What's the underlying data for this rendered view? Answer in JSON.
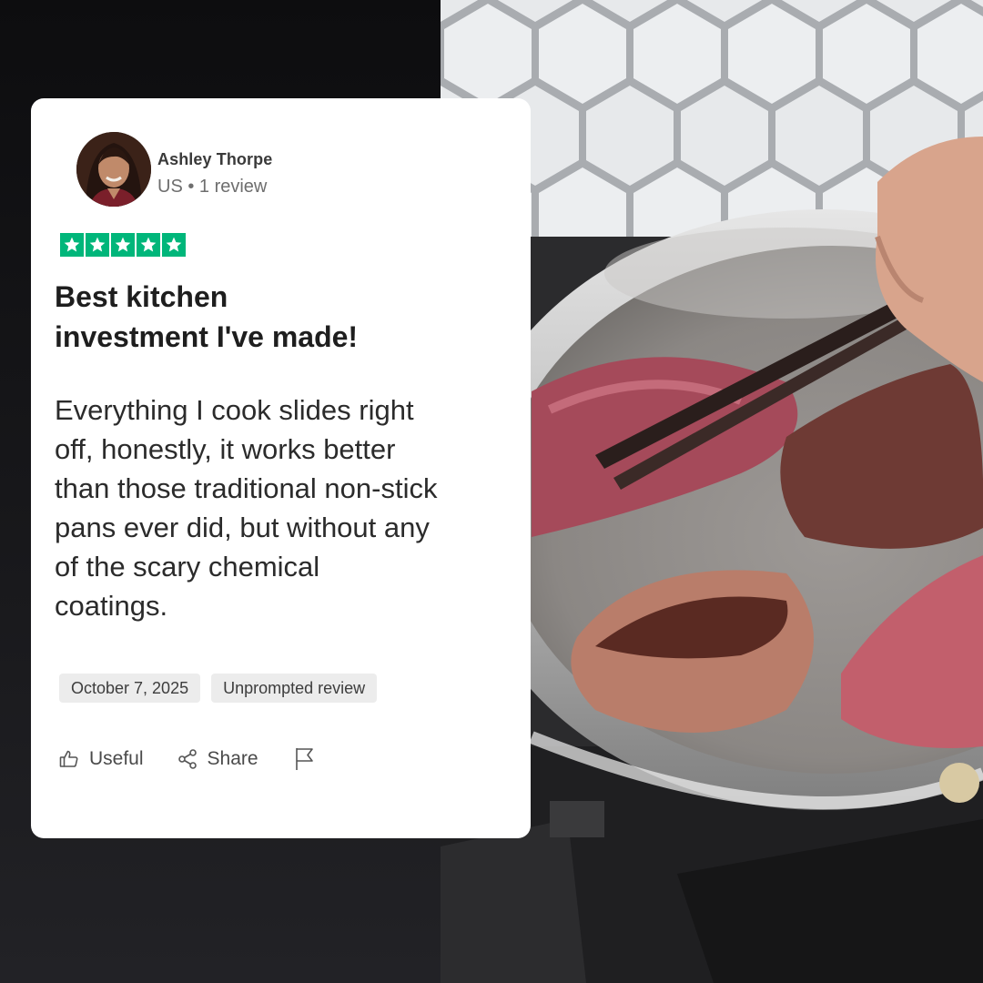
{
  "reviewer": {
    "name": "Ashley Thorpe",
    "meta": "US • 1 review"
  },
  "rating": {
    "stars": 5,
    "star_color": "#00b67a"
  },
  "review": {
    "title_line1": "Best kitchen",
    "title_line2": "investment I've made!",
    "body_lines": [
      "Everything I cook slides right",
      "off, honestly, it works better",
      "than those traditional non-stick",
      "pans ever did, but without any",
      "of the scary chemical",
      "coatings."
    ]
  },
  "tags": {
    "date": "October 7, 2025",
    "label": "Unprompted review"
  },
  "actions": {
    "useful_label": "Useful",
    "useful_icon": "thumbs-up-icon",
    "share_label": "Share",
    "share_icon": "share-icon",
    "report_icon": "flag-icon"
  }
}
